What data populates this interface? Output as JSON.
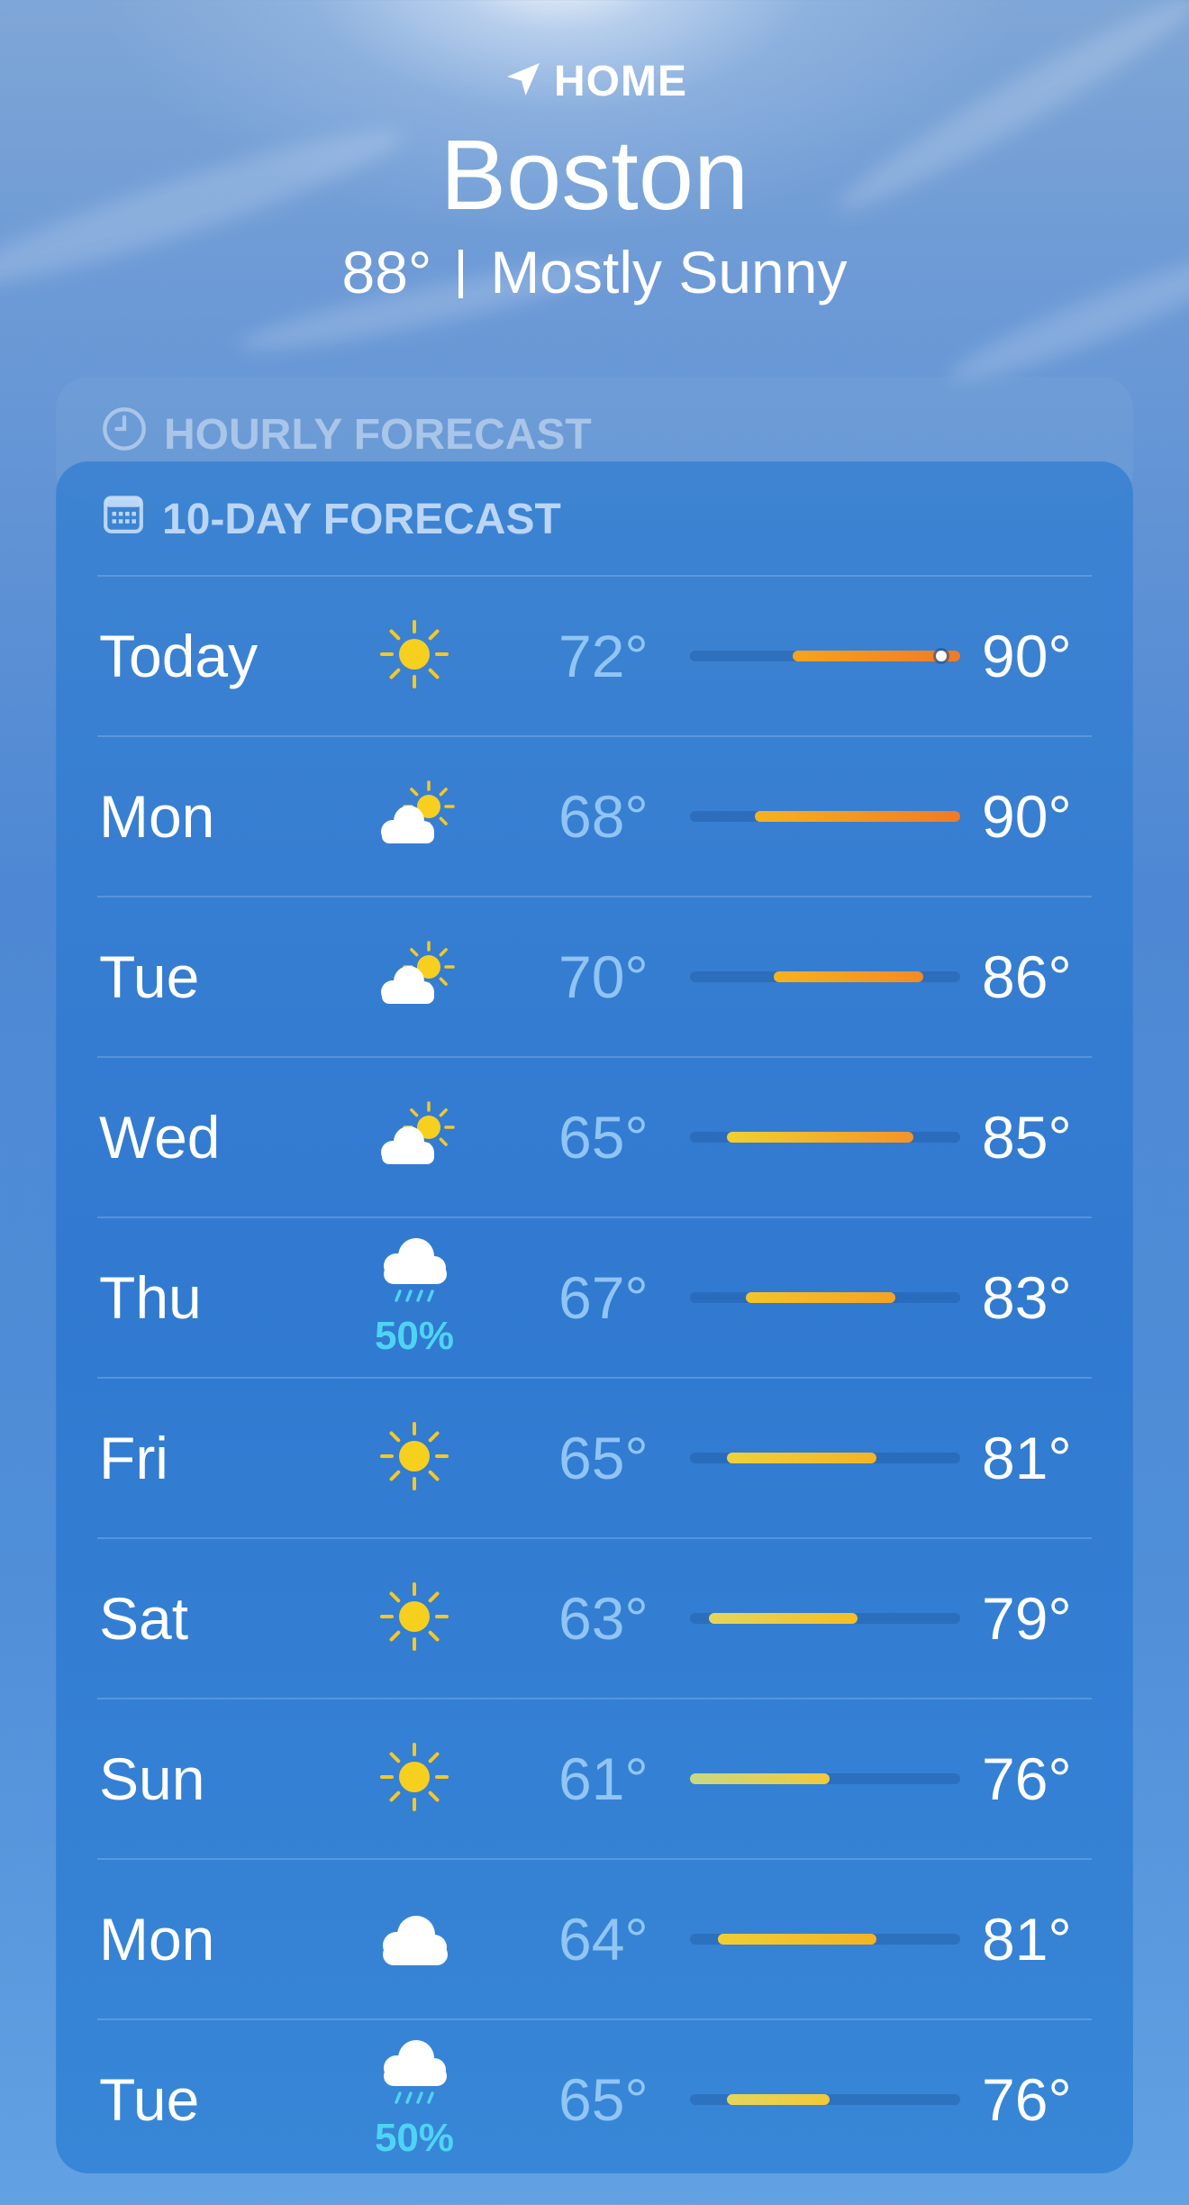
{
  "header": {
    "location_label": "HOME",
    "city": "Boston",
    "current_temp": "88°",
    "condition": "Mostly Sunny"
  },
  "hourly": {
    "title": "HOURLY FORECAST"
  },
  "ten_day": {
    "title": "10-DAY FORECAST",
    "range": {
      "min": 61,
      "max": 90
    },
    "current_temp_value": 88,
    "days": [
      {
        "day": "Today",
        "icon": "sun-icon",
        "precip": "",
        "low": "72°",
        "high": "90°",
        "low_value": 72,
        "high_value": 90,
        "color_from": "#f7a31c",
        "color_to": "#f07a26",
        "current": true
      },
      {
        "day": "Mon",
        "icon": "partly-cloudy-icon",
        "precip": "",
        "low": "68°",
        "high": "90°",
        "low_value": 68,
        "high_value": 90,
        "color_from": "#f6b21e",
        "color_to": "#f07a26",
        "current": false
      },
      {
        "day": "Tue",
        "icon": "partly-cloudy-icon",
        "precip": "",
        "low": "70°",
        "high": "86°",
        "low_value": 70,
        "high_value": 86,
        "color_from": "#f6b21e",
        "color_to": "#f38a24",
        "current": false
      },
      {
        "day": "Wed",
        "icon": "partly-cloudy-icon",
        "precip": "",
        "low": "65°",
        "high": "85°",
        "low_value": 65,
        "high_value": 85,
        "color_from": "#f0d032",
        "color_to": "#f39427",
        "current": false
      },
      {
        "day": "Thu",
        "icon": "rain-cloud-icon",
        "precip": "50%",
        "low": "67°",
        "high": "83°",
        "low_value": 67,
        "high_value": 83,
        "color_from": "#f3c52a",
        "color_to": "#f4a224",
        "current": false
      },
      {
        "day": "Fri",
        "icon": "sun-icon",
        "precip": "",
        "low": "65°",
        "high": "81°",
        "low_value": 65,
        "high_value": 81,
        "color_from": "#eed23a",
        "color_to": "#f4b324",
        "current": false
      },
      {
        "day": "Sat",
        "icon": "sun-icon",
        "precip": "",
        "low": "63°",
        "high": "79°",
        "low_value": 63,
        "high_value": 79,
        "color_from": "#e4d65c",
        "color_to": "#f4be24",
        "current": false
      },
      {
        "day": "Sun",
        "icon": "sun-icon",
        "precip": "",
        "low": "61°",
        "high": "76°",
        "low_value": 61,
        "high_value": 76,
        "color_from": "#c8d984",
        "color_to": "#f2c93a",
        "current": false
      },
      {
        "day": "Mon",
        "icon": "cloud-icon",
        "precip": "",
        "low": "64°",
        "high": "81°",
        "low_value": 64,
        "high_value": 81,
        "color_from": "#efcf34",
        "color_to": "#f4b324",
        "current": false
      },
      {
        "day": "Tue",
        "icon": "rain-cloud-icon",
        "precip": "50%",
        "low": "65°",
        "high": "76°",
        "low_value": 65,
        "high_value": 76,
        "color_from": "#e4d65c",
        "color_to": "#f2c93a",
        "current": false
      }
    ]
  }
}
